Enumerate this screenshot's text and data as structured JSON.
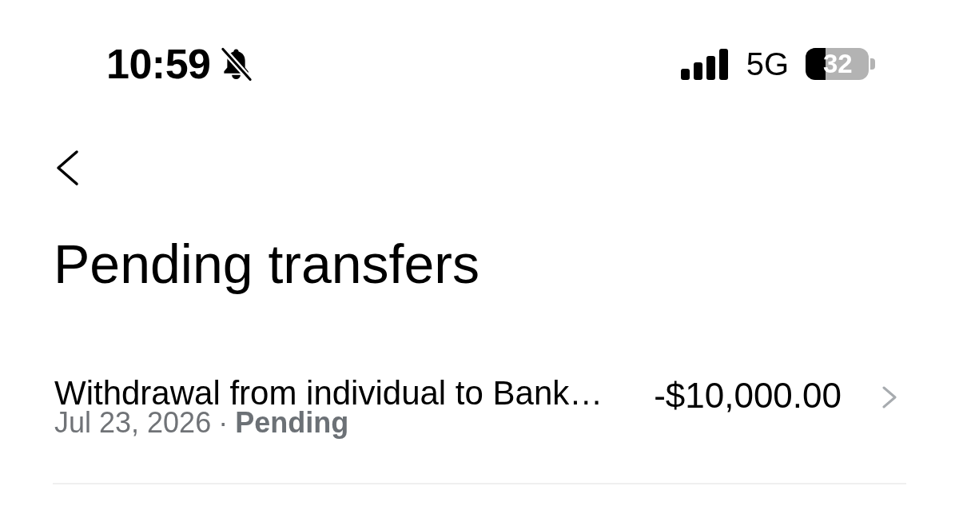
{
  "status_bar": {
    "time": "10:59",
    "silent": true,
    "network": "5G",
    "battery": "32"
  },
  "header": {
    "title": "Pending transfers"
  },
  "transfers": [
    {
      "title": "Withdrawal from individual to Bank…",
      "date": "Jul 23, 2026",
      "separator": "·",
      "status": "Pending",
      "amount": "-$10,000.00"
    }
  ]
}
